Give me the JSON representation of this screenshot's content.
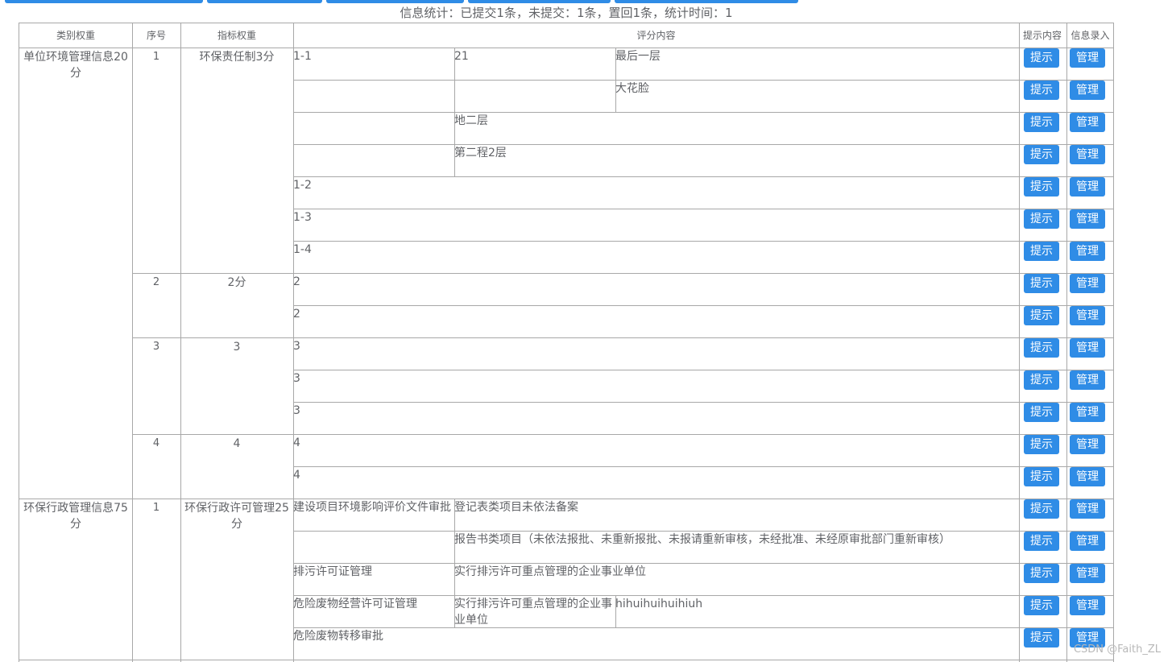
{
  "stats_text": "信息统计：已提交1条，未提交：1条，置回1条，统计时间：1",
  "headers": {
    "category": "类别权重",
    "seq": "序号",
    "indicator": "指标权重",
    "content": "评分内容",
    "hint": "提示内容",
    "entry": "信息录入"
  },
  "categories": [
    {
      "label": "单位环境管理信息20分"
    },
    {
      "label": "环保行政管理信息75分"
    }
  ],
  "seq": [
    "1",
    "2",
    "3",
    "4",
    "1"
  ],
  "indicators": [
    "环保责任制3分",
    "2分",
    "3",
    "4",
    "环保行政许可管理25分"
  ],
  "rows": [
    {
      "c1": "1-1",
      "c2": "21",
      "c3": "最后一层"
    },
    {
      "c1": "",
      "c2": "",
      "c3": "大花脸"
    },
    {
      "c1": "",
      "c2": "地二层",
      "c3": ""
    },
    {
      "c1": "",
      "c2": "第二程2层",
      "c3": ""
    },
    {
      "c1": "1-2",
      "c2": "",
      "c3": ""
    },
    {
      "c1": "1-3",
      "c2": "",
      "c3": ""
    },
    {
      "c1": "1-4",
      "c2": "",
      "c3": ""
    },
    {
      "c1": "2",
      "c2": "",
      "c3": ""
    },
    {
      "c1": "2",
      "c2": "",
      "c3": ""
    },
    {
      "c1": "3",
      "c2": "",
      "c3": ""
    },
    {
      "c1": "3",
      "c2": "",
      "c3": ""
    },
    {
      "c1": "3",
      "c2": "",
      "c3": ""
    },
    {
      "c1": "4",
      "c2": "",
      "c3": ""
    },
    {
      "c1": "4",
      "c2": "",
      "c3": ""
    },
    {
      "c1": "建设项目环境影响评价文件审批",
      "c2": "登记表类项目未依法备案",
      "c3": ""
    },
    {
      "c1": "",
      "c2": "报告书类项目（未依法报批、未重新报批、未报请重新审核，未经批准、未经原审批部门重新审核）",
      "c3": ""
    },
    {
      "c1": "排污许可证管理",
      "c2": "实行排污许可重点管理的企业事业单位",
      "c3": ""
    },
    {
      "c1": "危险废物经营许可证管理",
      "c2": "实行排污许可重点管理的企业事业单位",
      "c3": "hihuihuihuihiuh"
    },
    {
      "c1": "危险废物转移审批",
      "c2": "",
      "c3": ""
    }
  ],
  "buttons": {
    "hint_label": "提示",
    "manage_label": "管理"
  },
  "watermark": "CSDN @Faith_ZL",
  "colors": {
    "primary": "#2f8ce6",
    "border": "#a8a8a8",
    "text": "#606266"
  }
}
